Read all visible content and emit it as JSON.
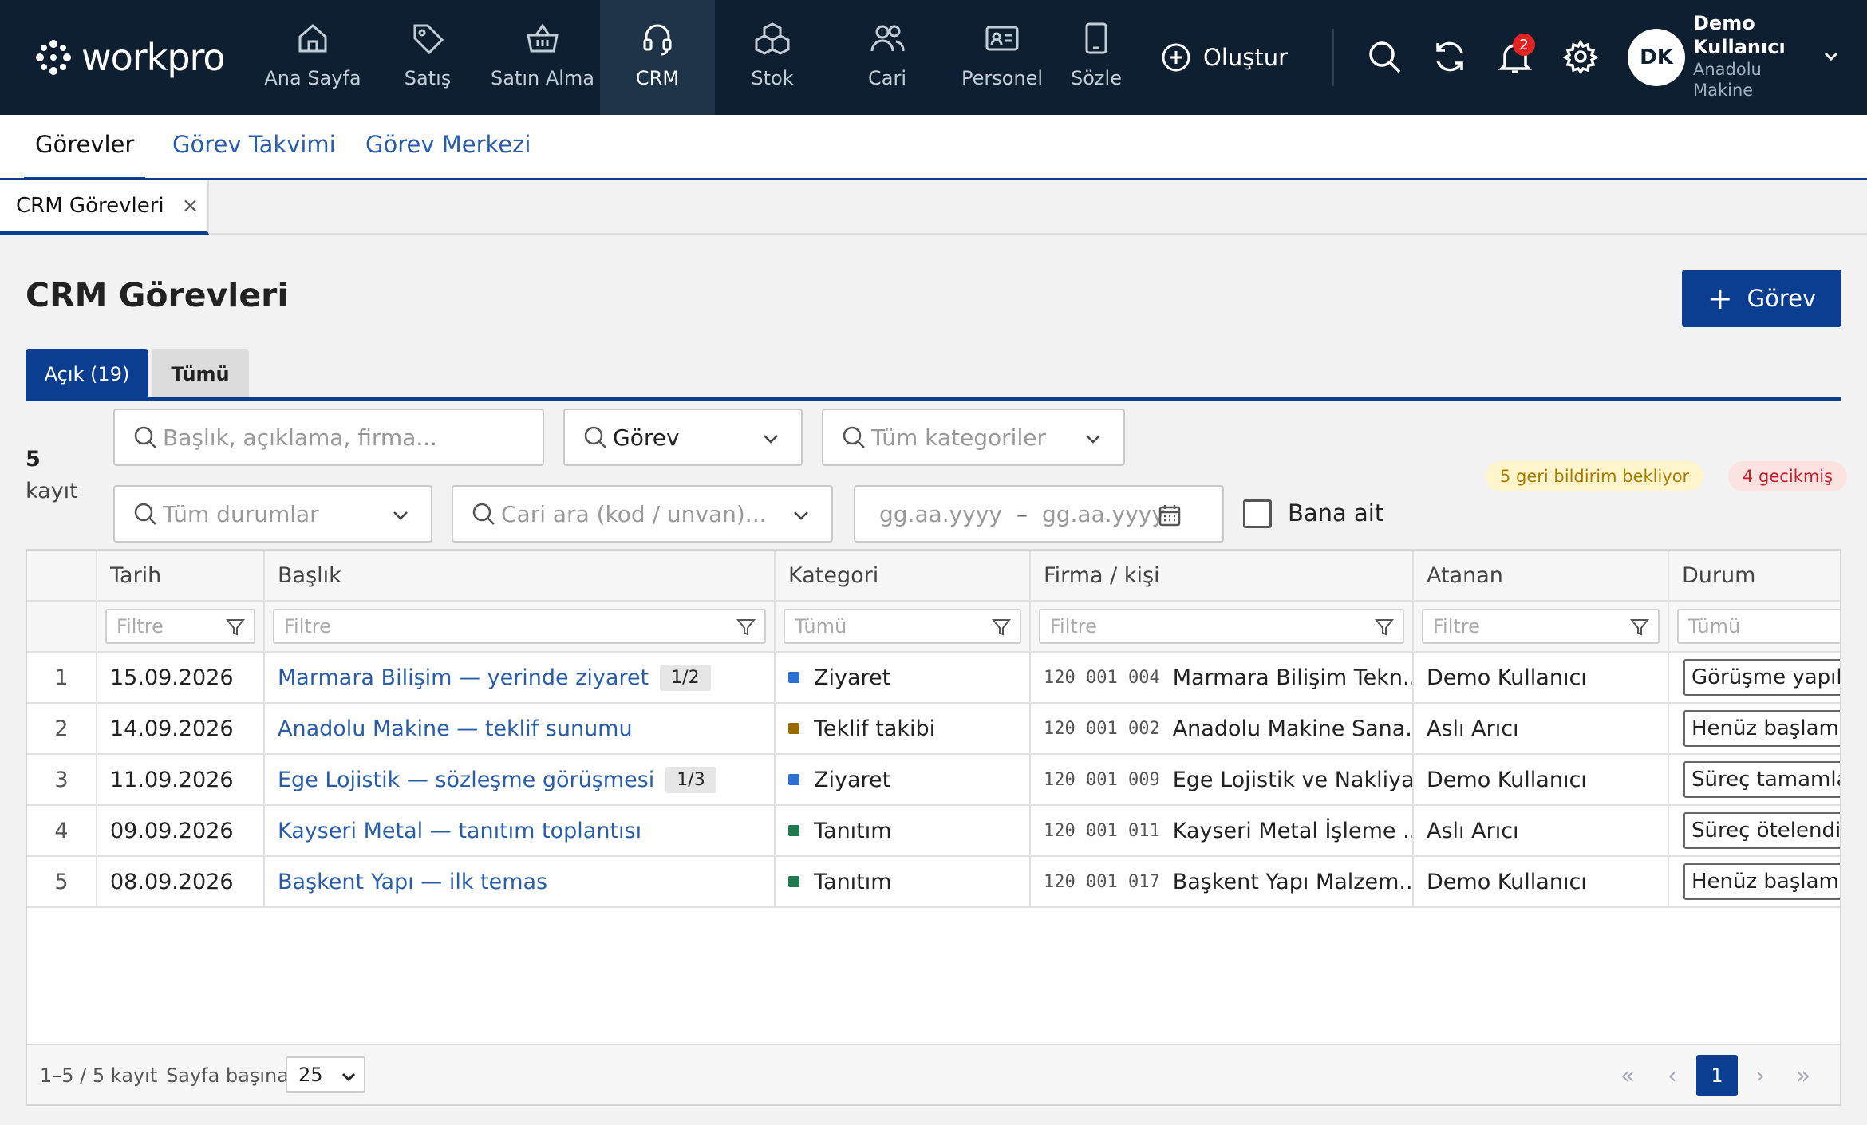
{
  "app": {
    "logo_text": "workpro",
    "nav": [
      {
        "label": "Ana Sayfa",
        "icon": "home-icon"
      },
      {
        "label": "Satış",
        "icon": "tag-icon"
      },
      {
        "label": "Satın Alma",
        "icon": "basket-icon"
      },
      {
        "label": "CRM",
        "icon": "headset-icon",
        "active": true
      },
      {
        "label": "Stok",
        "icon": "boxes-icon"
      },
      {
        "label": "Cari",
        "icon": "users-icon"
      },
      {
        "label": "Personel",
        "icon": "id-card-icon"
      },
      {
        "label": "Sözle",
        "icon": "tablet-icon"
      }
    ],
    "create_label": "Oluştur",
    "notification_count": "2",
    "user": {
      "initials": "DK",
      "name": "Demo Kullanıcı",
      "company": "Anadolu Makine"
    }
  },
  "subtabs": [
    "Görevler",
    "Görev Takvimi",
    "Görev Merkezi"
  ],
  "doc_tab": {
    "label": "CRM Görevleri",
    "close": "×"
  },
  "page": {
    "title": "CRM Görevleri",
    "new_button": "Görev",
    "seg_open": "Açık (19)",
    "seg_all": "Tümü",
    "count": "5",
    "count_label": "kayıt"
  },
  "filters": {
    "search_placeholder": "Başlık, açıklama, firma...",
    "type_value": "Görev",
    "category_placeholder": "Tüm kategoriler",
    "status_placeholder": "Tüm durumlar",
    "cari_placeholder": "Cari ara (kod / unvan)...",
    "date_from": "gg.aa.yyyy",
    "date_sep": "–",
    "date_to": "gg.aa.yyyy",
    "mine_label": "Bana ait",
    "feedback_badge": "5 geri bildirim bekliyor",
    "overdue_badge": "4 gecikmiş"
  },
  "grid": {
    "columns": [
      "Tarih",
      "Başlık",
      "Kategori",
      "Firma / kişi",
      "Atanan",
      "Durum"
    ],
    "filter_placeholders": [
      "Filtre",
      "Filtre",
      "Tümü",
      "Filtre",
      "Filtre",
      "Tümü"
    ],
    "rows": [
      {
        "n": "1",
        "date": "15.09.2026",
        "title": "Marmara Bilişim — yerinde ziyaret",
        "chip": "1/2",
        "category": "Ziyaret",
        "cat_color": "#2a6fd4",
        "code": "120 001 004",
        "firm": "Marmara Bilişim Tekn...",
        "assignee": "Demo Kullanıcı",
        "status": "Görüşme yapıld"
      },
      {
        "n": "2",
        "date": "14.09.2026",
        "title": "Anadolu Makine — teklif sunumu",
        "chip": "",
        "category": "Teklif takibi",
        "cat_color": "#9a6a00",
        "code": "120 001 002",
        "firm": "Anadolu Makine Sana...",
        "assignee": "Aslı Arıcı",
        "status": "Henüz başlama"
      },
      {
        "n": "3",
        "date": "11.09.2026",
        "title": "Ege Lojistik — sözleşme görüşmesi",
        "chip": "1/3",
        "category": "Ziyaret",
        "cat_color": "#2a6fd4",
        "code": "120 001 009",
        "firm": "Ege Lojistik ve Nakliyat",
        "assignee": "Demo Kullanıcı",
        "status": "Süreç tamamlan"
      },
      {
        "n": "4",
        "date": "09.09.2026",
        "title": "Kayseri Metal — tanıtım toplantısı",
        "chip": "",
        "category": "Tanıtım",
        "cat_color": "#1f7a4f",
        "code": "120 001 011",
        "firm": "Kayseri Metal İşleme ...",
        "assignee": "Aslı Arıcı",
        "status": "Süreç ötelendi"
      },
      {
        "n": "5",
        "date": "08.09.2026",
        "title": "Başkent Yapı — ilk temas",
        "chip": "",
        "category": "Tanıtım",
        "cat_color": "#1f7a4f",
        "code": "120 001 017",
        "firm": "Başkent Yapı Malzem...",
        "assignee": "Demo Kullanıcı",
        "status": "Henüz başlama"
      }
    ]
  },
  "pager": {
    "range": "1–5 / 5 kayıt",
    "per_page_label": "Sayfa başına",
    "per_page": "25",
    "first": "«",
    "prev": "‹",
    "current": "1",
    "next": "›",
    "last": "»"
  }
}
